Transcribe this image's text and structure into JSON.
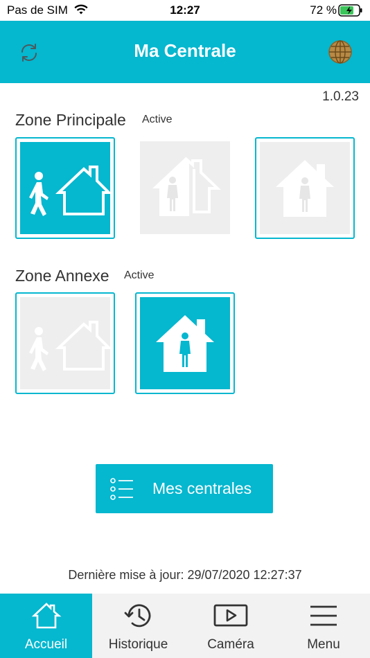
{
  "status_bar": {
    "carrier": "Pas de SIM",
    "time": "12:27",
    "battery": "72 %"
  },
  "header": {
    "title": "Ma Centrale",
    "refresh_icon": "refresh-icon",
    "globe_icon": "globe-icon"
  },
  "version": "1.0.23",
  "zones": [
    {
      "name": "Zone Principale",
      "status": "Active",
      "modes": [
        {
          "icon": "walking-away-icon",
          "state": "selected"
        },
        {
          "icon": "partial-house-icon",
          "state": "unavailable"
        },
        {
          "icon": "person-in-house-icon",
          "state": "available"
        }
      ]
    },
    {
      "name": "Zone Annexe",
      "status": "Active",
      "modes": [
        {
          "icon": "walking-away-icon",
          "state": "available"
        },
        {
          "icon": "person-in-house-icon",
          "state": "selected"
        }
      ]
    }
  ],
  "mes_centrales_button": {
    "label": "Mes centrales",
    "icon": "list-icon"
  },
  "last_update": "Dernière mise à jour: 29/07/2020 12:27:37",
  "tabs": [
    {
      "label": "Accueil",
      "icon": "home-icon",
      "active": true
    },
    {
      "label": "Historique",
      "icon": "history-icon",
      "active": false
    },
    {
      "label": "Caméra",
      "icon": "camera-play-icon",
      "active": false
    },
    {
      "label": "Menu",
      "icon": "hamburger-menu-icon",
      "active": false
    }
  ],
  "colors": {
    "accent": "#05b7cf",
    "tile_background": "#eeeeee",
    "text": "#333333"
  }
}
